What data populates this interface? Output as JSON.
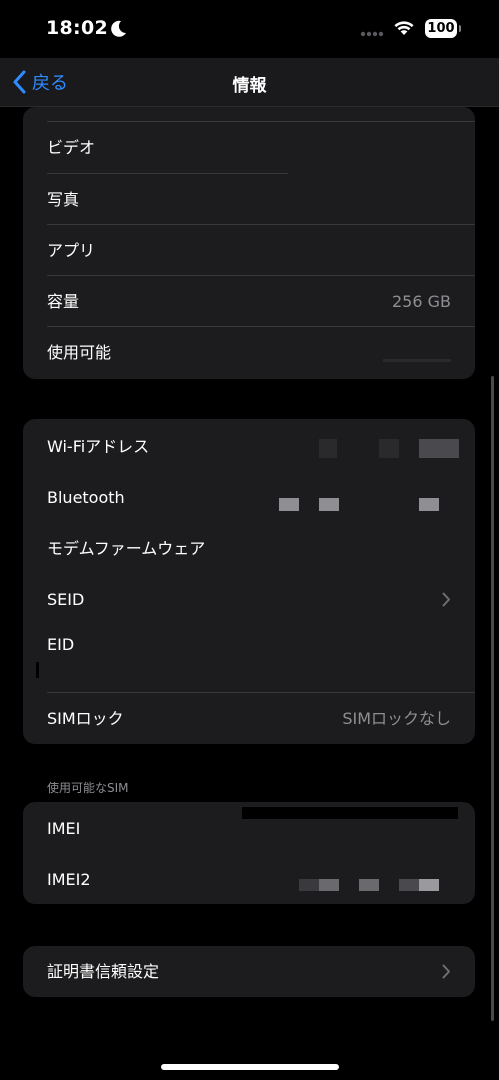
{
  "status": {
    "time": "18:02",
    "battery": "100"
  },
  "nav": {
    "back_label": "戻る",
    "title": "情報"
  },
  "storage": {
    "rows": [
      {
        "label": "ビデオ",
        "value": ""
      },
      {
        "label": "写真",
        "value": ""
      },
      {
        "label": "アプリ",
        "value": ""
      },
      {
        "label": "容量",
        "value": "256 GB"
      },
      {
        "label": "使用可能",
        "value": ""
      }
    ]
  },
  "network": {
    "rows": [
      {
        "label": "Wi-Fiアドレス",
        "value": ""
      },
      {
        "label": "Bluetooth",
        "value": ""
      },
      {
        "label": "モデムファームウェア",
        "value": ""
      },
      {
        "label": "SEID",
        "value": ""
      },
      {
        "label": "EID",
        "value": ""
      },
      {
        "label": "SIMロック",
        "value": "SIMロックなし"
      }
    ]
  },
  "sim": {
    "section_label": "使用可能なSIM",
    "rows": [
      {
        "label": "IMEI",
        "value": ""
      },
      {
        "label": "IMEI2",
        "value": ""
      }
    ]
  },
  "certificate": {
    "label": "証明書信頼設定"
  },
  "icons": {
    "back": "chevron-left-icon",
    "moon": "moon-icon",
    "wifi": "wifi-icon",
    "signal": "cellular-signal-icon",
    "chevron": "chevron-right-icon"
  },
  "colors": {
    "accent": "#2f8cff",
    "card": "#1c1c1e",
    "secondary_text": "#8e8e93",
    "background": "#000000"
  }
}
